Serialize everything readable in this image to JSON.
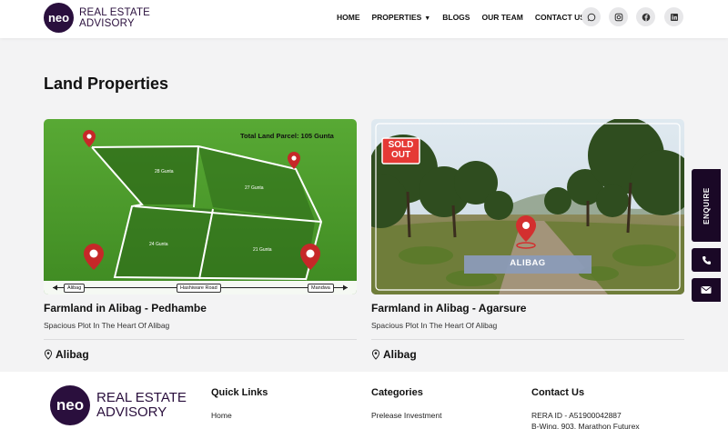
{
  "brand": {
    "mark": "neo",
    "line1": "REAL ESTATE",
    "line2": "ADVISORY",
    "color": "#2a0f3d"
  },
  "nav": [
    {
      "label": "HOME"
    },
    {
      "label": "PROPERTIES"
    },
    {
      "label": "BLOGS"
    },
    {
      "label": "OUR TEAM"
    },
    {
      "label": "CONTACT US"
    }
  ],
  "social_icons": [
    "whatsapp-icon",
    "instagram-icon",
    "facebook-icon",
    "linkedin-icon"
  ],
  "page": {
    "title": "Land Properties"
  },
  "cards": [
    {
      "title": "Farmland in Alibag - Pedhambe",
      "subtitle": "Spacious Plot In The Heart Of Alibag",
      "location": "Alibag",
      "image": {
        "parcel_total": "Total Land Parcel: 105 Gunta",
        "plots": [
          "28 Gunta",
          "27 Gunta",
          "24 Gunta",
          "21 Gunta"
        ],
        "road_left": "Alibag",
        "road_center": "Hashiware Road",
        "road_right": "Mandwa"
      }
    },
    {
      "title": "Farmland in Alibag - Agarsure",
      "subtitle": "Spacious Plot In The Heart Of Alibag",
      "location": "Alibag",
      "image": {
        "badge_line1": "SOLD",
        "badge_line2": "OUT",
        "place": "ALIBAG"
      }
    }
  ],
  "float": {
    "enquire": "ENQUIRE"
  },
  "footer": {
    "quick_links": {
      "heading": "Quick Links",
      "items": [
        "Home"
      ]
    },
    "categories": {
      "heading": "Categories",
      "items": [
        "Prelease Investment"
      ]
    },
    "contact": {
      "heading": "Contact Us",
      "rera": "RERA ID - A51900042887",
      "address": "B-Wing, 903, Marathon Futurex"
    }
  }
}
